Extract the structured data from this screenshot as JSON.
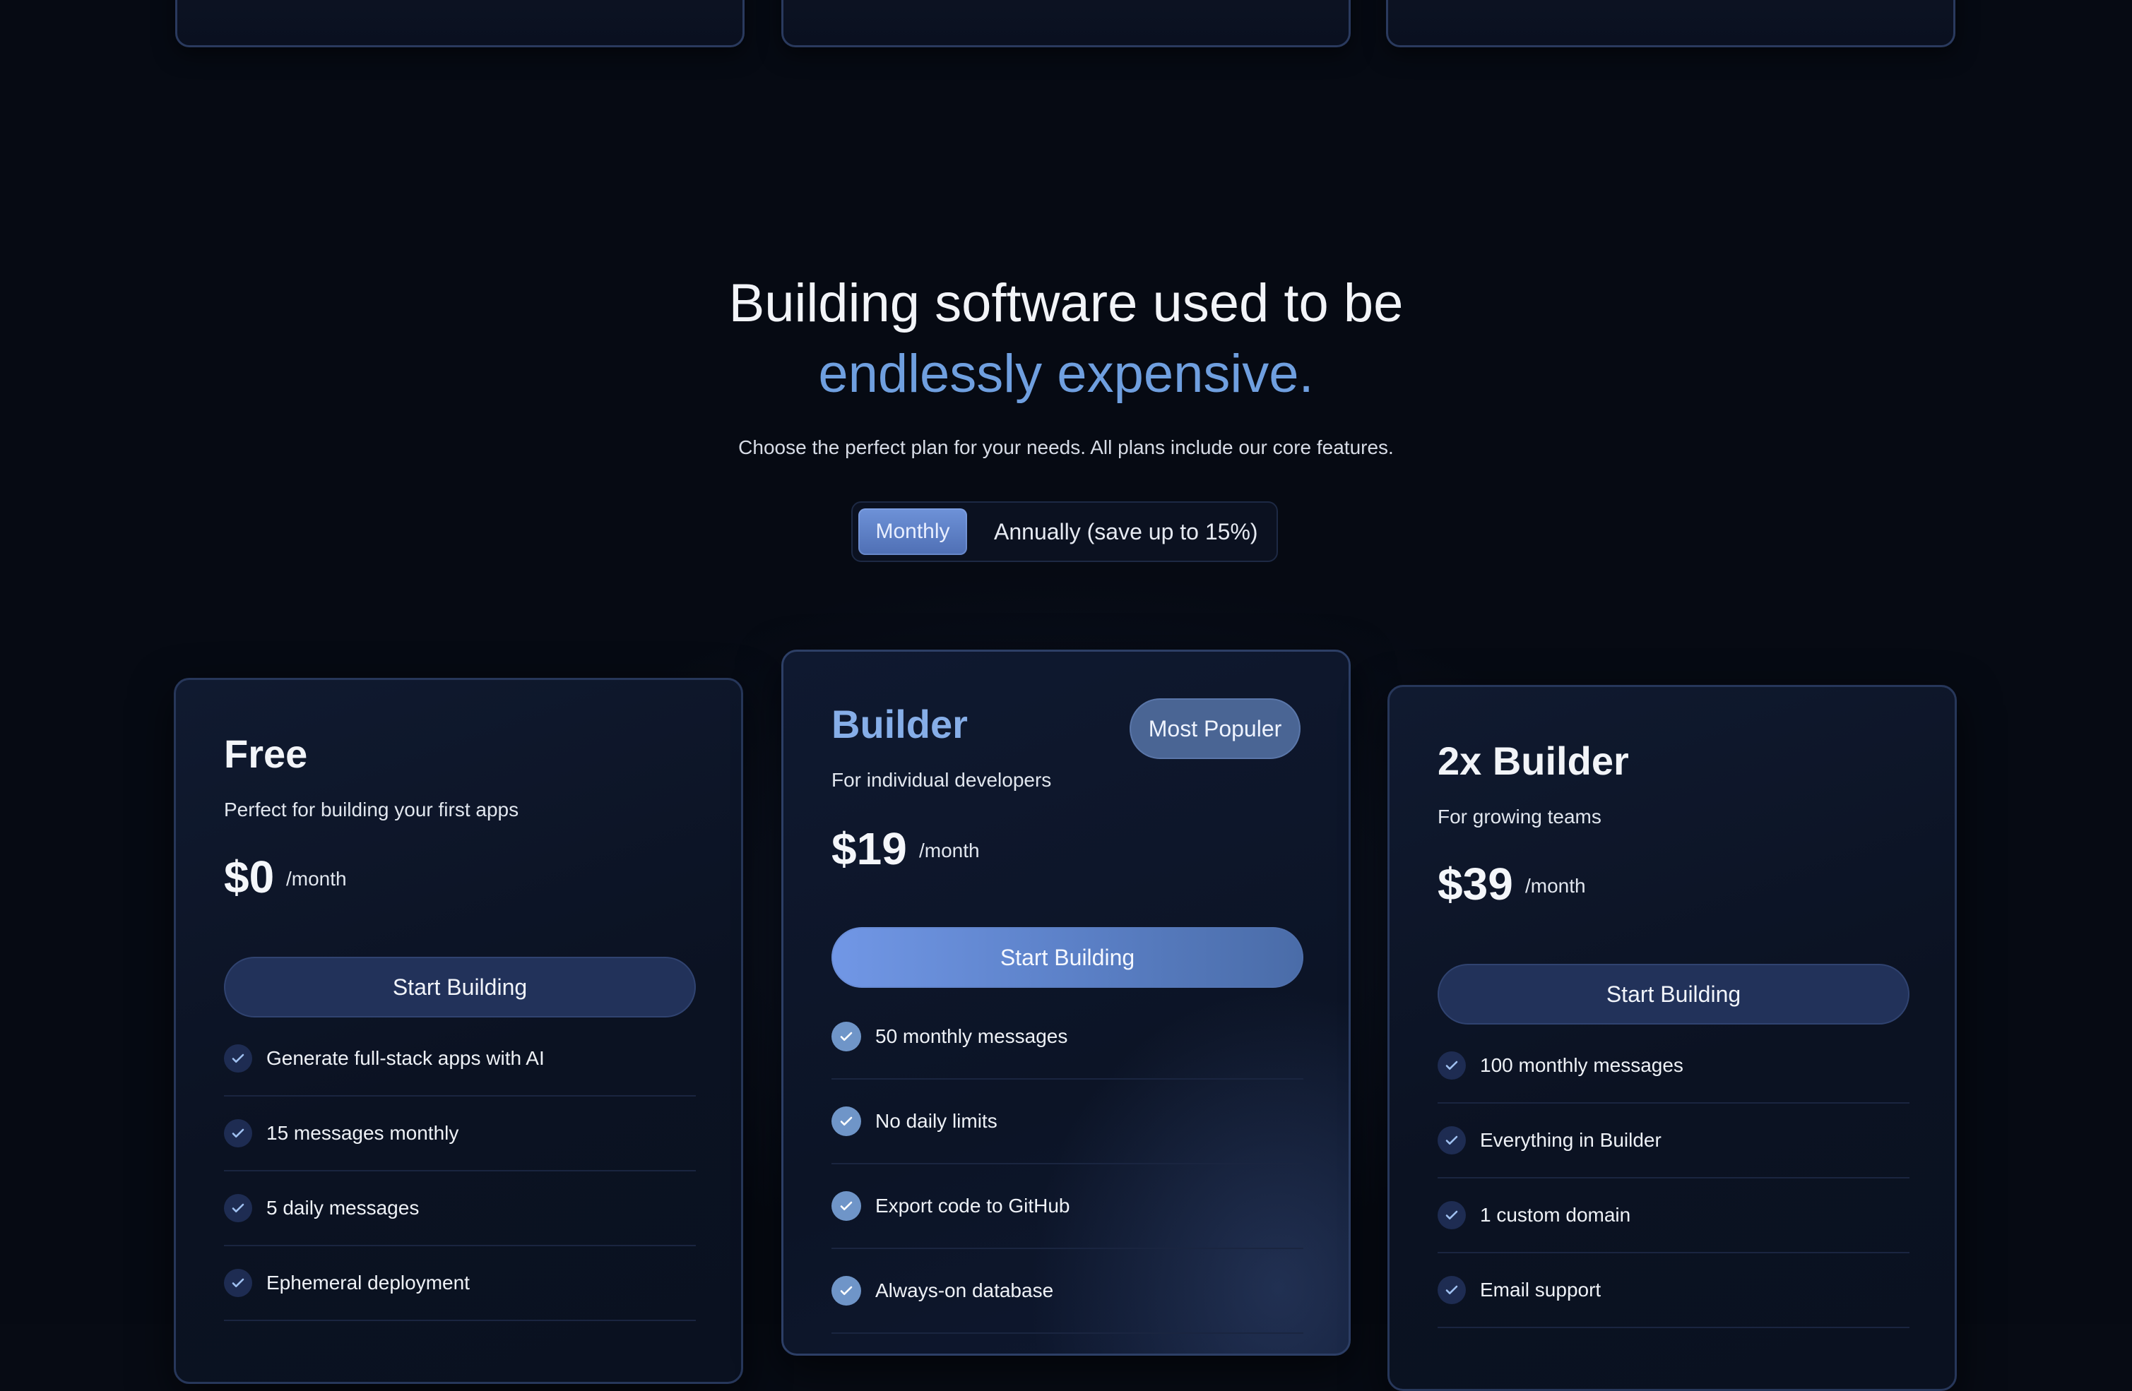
{
  "hero": {
    "title_line1": "Building software used to be",
    "title_line2": "endlessly expensive.",
    "subtitle": "Choose the perfect plan for your needs. All plans include our core features."
  },
  "billing_toggle": {
    "monthly_label": "Monthly",
    "annual_label": "Annually (save up to 15%)",
    "selected": "Monthly"
  },
  "plans": [
    {
      "name": "Free",
      "description": "Perfect for building your first apps",
      "price": "$0",
      "period": "/month",
      "cta": "Start Building",
      "features": [
        "Generate full-stack apps with AI",
        "15 messages monthly",
        "5 daily messages",
        "Ephemeral deployment"
      ]
    },
    {
      "name": "Builder",
      "badge": "Most Populer",
      "description": "For individual developers",
      "price": "$19",
      "period": "/month",
      "cta": "Start Building",
      "features": [
        "50 monthly messages",
        "No daily limits",
        "Export code to GitHub",
        "Always-on database"
      ]
    },
    {
      "name": "2x Builder",
      "description": "For growing teams",
      "price": "$39",
      "period": "/month",
      "cta": "Start Building",
      "features": [
        "100 monthly messages",
        "Everything in Builder",
        "1 custom domain",
        "Email support"
      ]
    }
  ],
  "colors": {
    "background": "#060a13",
    "accent": "#6f9fdf",
    "card_border": "#27375a",
    "cta_primary_start": "#7197e6",
    "cta_primary_end": "#4a6ca8",
    "check_fill": "#1e2c52"
  }
}
